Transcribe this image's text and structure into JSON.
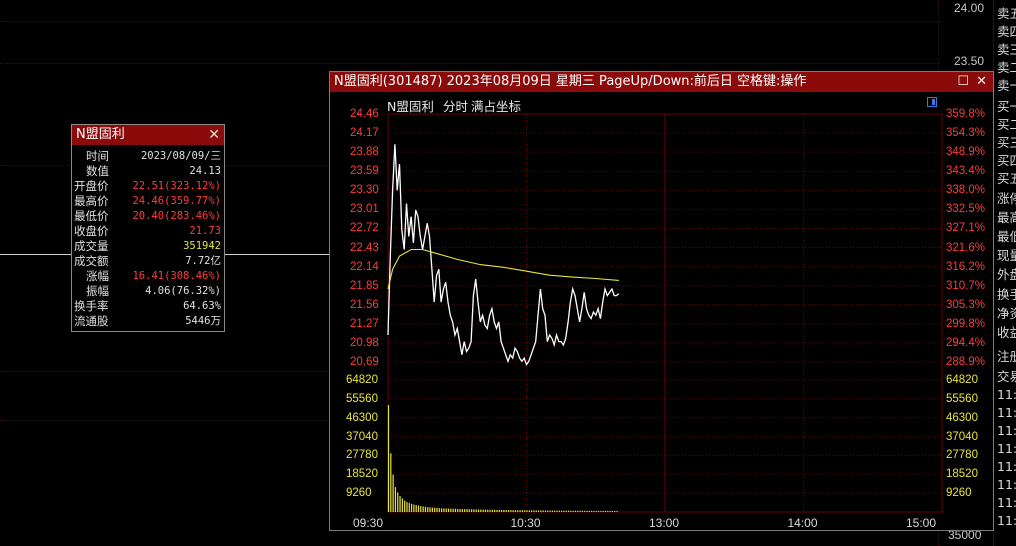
{
  "colors": {
    "red": "#ff3b3b",
    "yellow": "#e8e53a",
    "white": "#ffffff",
    "grid": "#6a0000",
    "title_bg": "#8b0b0b"
  },
  "background": {
    "price_labels": [
      "24.00",
      "23.50",
      "35000"
    ]
  },
  "right_panel": {
    "items": [
      "卖五",
      "卖四",
      "卖三",
      "卖二",
      "卖一",
      "买一",
      "买二",
      "买三",
      "买四",
      "买五",
      "涨停",
      "最高",
      "最低",
      "现量",
      "外盘",
      "换手",
      "净资",
      "收益",
      "注册",
      "交易",
      "11:",
      "11:",
      "11:",
      "11:",
      "11:",
      "11:",
      "11:",
      "11:"
    ]
  },
  "info_popup": {
    "title": "N盟固利",
    "close_icon": "close-icon",
    "rows": [
      {
        "label": "时间",
        "value": "2023/08/09/三",
        "color": "#e0e0e0"
      },
      {
        "label": "数值",
        "value": "24.13",
        "color": "#e0e0e0"
      },
      {
        "label": "开盘价",
        "value": "22.51(323.12%)",
        "color": "#ff3b3b"
      },
      {
        "label": "最高价",
        "value": "24.46(359.77%)",
        "color": "#ff3b3b"
      },
      {
        "label": "最低价",
        "value": "20.40(283.46%)",
        "color": "#ff3b3b"
      },
      {
        "label": "收盘价",
        "value": "21.73",
        "color": "#ff3b3b"
      },
      {
        "label": "成交量",
        "value": "351942",
        "color": "#e8e53a"
      },
      {
        "label": "成交额",
        "value": "7.72亿",
        "color": "#e0e0e0"
      },
      {
        "label": "涨幅",
        "value": "16.41(308.46%)",
        "color": "#ff3b3b"
      },
      {
        "label": "振幅",
        "value": "4.06(76.32%)",
        "color": "#e0e0e0"
      },
      {
        "label": "换手率",
        "value": "64.63%",
        "color": "#e0e0e0"
      },
      {
        "label": "流通股",
        "value": "5446万",
        "color": "#e0e0e0"
      }
    ]
  },
  "window": {
    "title": "N盟固利(301487) 2023年08月09日 星期三 PageUp/Down:前后日 空格键:操作",
    "tabs": [
      "N盟固利",
      "分时",
      "满占坐标"
    ],
    "maximize_icon": "maximize-icon",
    "close_icon": "close-icon"
  },
  "chart_data": {
    "type": "line",
    "price_axis_left": [
      "24.46",
      "24.17",
      "23.88",
      "23.59",
      "23.30",
      "23.01",
      "22.72",
      "22.43",
      "22.14",
      "21.85",
      "21.56",
      "21.27",
      "20.98",
      "20.69"
    ],
    "pct_axis_right": [
      "359.8%",
      "354.3%",
      "348.9%",
      "343.4%",
      "338.0%",
      "332.5%",
      "327.1%",
      "321.6%",
      "316.2%",
      "310.7%",
      "305.3%",
      "299.8%",
      "294.4%",
      "288.9%"
    ],
    "volume_axis": [
      "64820",
      "55560",
      "46300",
      "37040",
      "27780",
      "18520",
      "9260"
    ],
    "x_ticks": [
      "09:30",
      "10:30",
      "13:00",
      "14:00",
      "15:00"
    ],
    "price_range": [
      20.69,
      24.46
    ],
    "volume_range": [
      0,
      74080
    ],
    "total_minutes": 240,
    "series": [
      {
        "role": "price",
        "color": "#ffffff",
        "points": [
          [
            0,
            21.1
          ],
          [
            1,
            22.3
          ],
          [
            2,
            23.3
          ],
          [
            3,
            24.0
          ],
          [
            4,
            23.3
          ],
          [
            5,
            23.7
          ],
          [
            6,
            22.7
          ],
          [
            7,
            22.4
          ],
          [
            8,
            23.1
          ],
          [
            9,
            22.6
          ],
          [
            10,
            22.9
          ],
          [
            11,
            22.5
          ],
          [
            12,
            23.0
          ],
          [
            13,
            22.9
          ],
          [
            14,
            22.6
          ],
          [
            15,
            22.4
          ],
          [
            16,
            22.6
          ],
          [
            17,
            22.8
          ],
          [
            18,
            22.6
          ],
          [
            19,
            22.1
          ],
          [
            20,
            21.6
          ],
          [
            21,
            22.0
          ],
          [
            22,
            22.1
          ],
          [
            23,
            21.6
          ],
          [
            24,
            21.8
          ],
          [
            25,
            21.9
          ],
          [
            26,
            21.6
          ],
          [
            27,
            21.4
          ],
          [
            28,
            21.3
          ],
          [
            29,
            21.1
          ],
          [
            30,
            21.2
          ],
          [
            31,
            21.0
          ],
          [
            32,
            20.8
          ],
          [
            33,
            21.0
          ],
          [
            34,
            20.85
          ],
          [
            35,
            20.9
          ],
          [
            36,
            21.0
          ],
          [
            37,
            21.7
          ],
          [
            38,
            21.95
          ],
          [
            39,
            21.6
          ],
          [
            40,
            21.3
          ],
          [
            41,
            21.4
          ],
          [
            42,
            21.25
          ],
          [
            43,
            21.2
          ],
          [
            44,
            21.4
          ],
          [
            45,
            21.5
          ],
          [
            46,
            21.3
          ],
          [
            47,
            21.2
          ],
          [
            48,
            21.3
          ],
          [
            49,
            21.0
          ],
          [
            50,
            20.9
          ],
          [
            51,
            20.8
          ],
          [
            52,
            20.7
          ],
          [
            53,
            20.8
          ],
          [
            54,
            20.75
          ],
          [
            55,
            20.9
          ],
          [
            56,
            20.85
          ],
          [
            57,
            20.75
          ],
          [
            58,
            20.7
          ],
          [
            59,
            20.75
          ],
          [
            60,
            20.65
          ],
          [
            61,
            20.7
          ],
          [
            62,
            20.8
          ],
          [
            63,
            20.9
          ],
          [
            64,
            21.0
          ],
          [
            65,
            21.4
          ],
          [
            66,
            21.8
          ],
          [
            67,
            21.5
          ],
          [
            68,
            21.4
          ],
          [
            69,
            21.0
          ],
          [
            70,
            21.1
          ],
          [
            71,
            21.05
          ],
          [
            72,
            20.95
          ],
          [
            73,
            21.1
          ],
          [
            74,
            21.0
          ],
          [
            75,
            21.0
          ],
          [
            76,
            20.95
          ],
          [
            77,
            21.05
          ],
          [
            78,
            21.3
          ],
          [
            79,
            21.6
          ],
          [
            80,
            21.8
          ],
          [
            81,
            21.7
          ],
          [
            82,
            21.5
          ],
          [
            83,
            21.3
          ],
          [
            84,
            21.5
          ],
          [
            85,
            21.75
          ],
          [
            86,
            21.5
          ],
          [
            87,
            21.4
          ],
          [
            88,
            21.35
          ],
          [
            89,
            21.45
          ],
          [
            90,
            21.4
          ],
          [
            91,
            21.5
          ],
          [
            92,
            21.35
          ],
          [
            93,
            21.6
          ],
          [
            94,
            21.8
          ],
          [
            95,
            21.7
          ],
          [
            96,
            21.75
          ],
          [
            97,
            21.8
          ],
          [
            98,
            21.7
          ],
          [
            99,
            21.7
          ],
          [
            100,
            21.73
          ]
        ]
      },
      {
        "role": "average",
        "color": "#e8e53a",
        "points": [
          [
            0,
            21.8
          ],
          [
            2,
            22.1
          ],
          [
            5,
            22.3
          ],
          [
            10,
            22.4
          ],
          [
            15,
            22.4
          ],
          [
            20,
            22.35
          ],
          [
            30,
            22.25
          ],
          [
            40,
            22.17
          ],
          [
            50,
            22.13
          ],
          [
            60,
            22.07
          ],
          [
            70,
            22.01
          ],
          [
            80,
            21.98
          ],
          [
            90,
            21.96
          ],
          [
            100,
            21.93
          ]
        ]
      }
    ],
    "volume": [
      60000,
      33000,
      21000,
      14000,
      11000,
      9000,
      7600,
      6400,
      5600,
      5000,
      4600,
      4200,
      3900,
      3600,
      3300,
      3100,
      2900,
      2700,
      2600,
      2500,
      2400,
      2300,
      2200,
      2100,
      2050,
      2000,
      1950,
      1900,
      1850,
      1800,
      1750,
      1700,
      1650,
      1600,
      1600,
      1550,
      1500,
      1500,
      1450,
      1400,
      1400,
      1350,
      1350,
      1300,
      1300,
      1250,
      1250,
      1200,
      1200,
      1150,
      1150,
      1100,
      1100,
      1100,
      1050,
      1050,
      1000,
      1000,
      1000,
      980,
      960,
      940,
      920,
      900,
      900,
      880,
      860,
      860,
      840,
      820,
      820,
      800,
      800,
      780,
      780,
      760,
      760,
      740,
      740,
      720,
      720,
      700,
      700,
      700,
      680,
      680,
      660,
      660,
      660,
      640,
      640,
      640,
      620,
      620,
      620,
      600,
      600,
      600,
      600,
      600
    ]
  }
}
